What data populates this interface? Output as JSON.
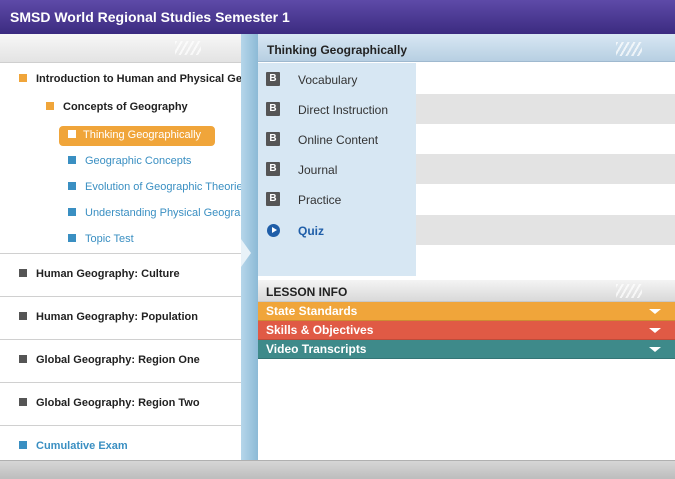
{
  "app": {
    "title": "SMSD World Regional Studies Semester 1"
  },
  "colors": {
    "orange": "#f0a53a",
    "link_blue": "#3a8fc2",
    "red": "#e05a45",
    "teal": "#3e8a8a",
    "title_purple": "#4a3894"
  },
  "sidebar": {
    "chapter": {
      "label": "Introduction to Human and Physical Ge",
      "icon": "orange-square-icon"
    },
    "section": {
      "label": "Concepts of Geography",
      "icon": "orange-square-icon"
    },
    "lessons": [
      {
        "label": "Thinking Geographically",
        "selected": true
      },
      {
        "label": "Geographic Concepts"
      },
      {
        "label": "Evolution of Geographic Theorie"
      },
      {
        "label": "Understanding Physical Geogra"
      },
      {
        "label": "Topic Test"
      }
    ],
    "units": [
      {
        "label": "Human Geography: Culture"
      },
      {
        "label": "Human Geography: Population"
      },
      {
        "label": "Global Geography: Region One"
      },
      {
        "label": "Global Geography: Region Two"
      }
    ],
    "exam": {
      "label": "Cumulative Exam"
    }
  },
  "lesson": {
    "title": "Thinking Geographically",
    "activities": [
      {
        "label": "Vocabulary",
        "icon": "B"
      },
      {
        "label": "Direct Instruction",
        "icon": "B"
      },
      {
        "label": "Online Content",
        "icon": "B"
      },
      {
        "label": "Journal",
        "icon": "B"
      },
      {
        "label": "Practice",
        "icon": "B"
      },
      {
        "label": "Quiz",
        "icon": "play-icon"
      }
    ]
  },
  "lesson_info": {
    "heading": "LESSON INFO",
    "sections": [
      {
        "label": "State Standards",
        "color": "#f0a53a"
      },
      {
        "label": "Skills & Objectives",
        "color": "#e05a45"
      },
      {
        "label": "Video Transcripts",
        "color": "#3e8a8a"
      }
    ]
  }
}
